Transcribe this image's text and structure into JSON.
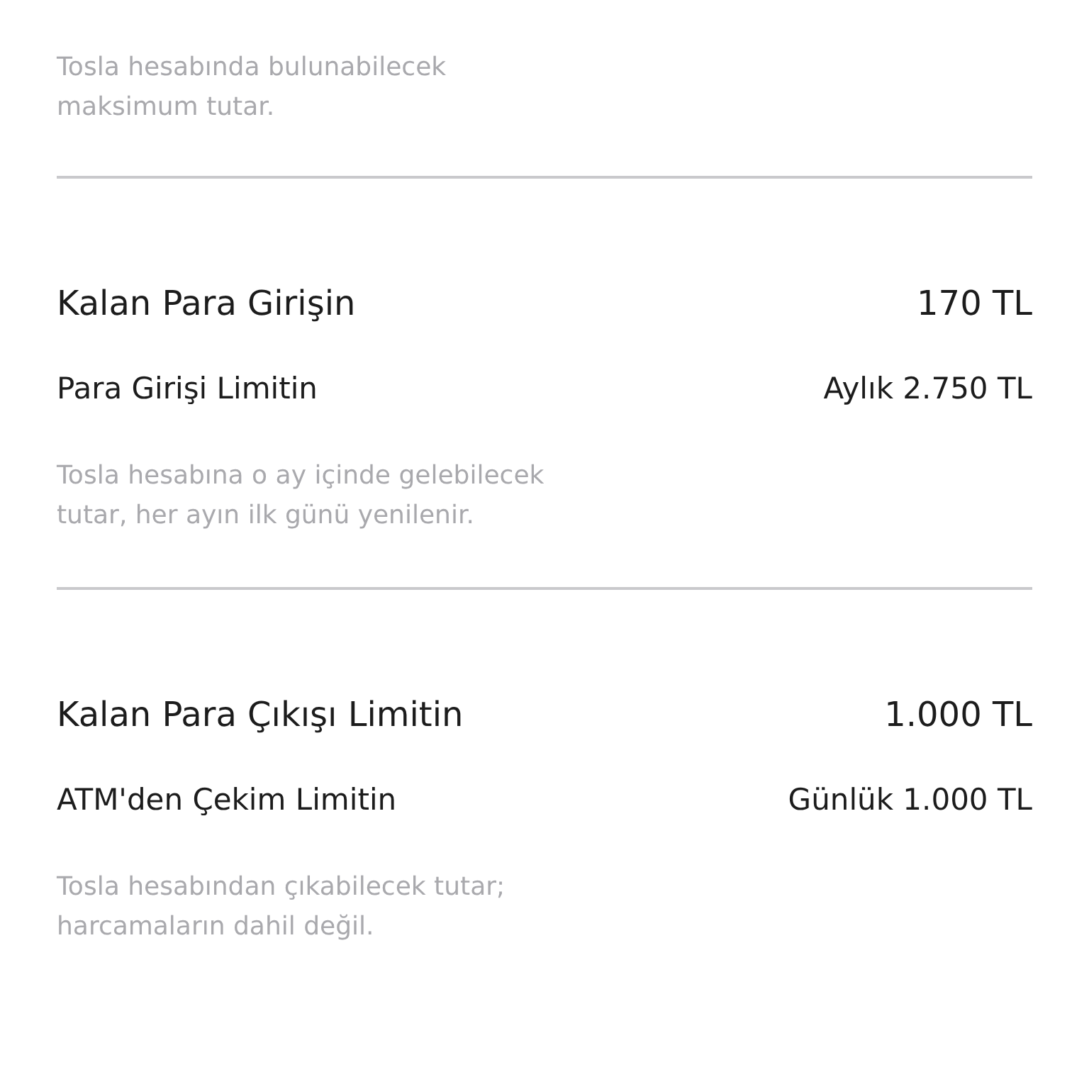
{
  "sections": [
    {
      "description": "Tosla hesabında bulunabilecek maksimum tutar."
    },
    {
      "title": "Kalan Para Girişin",
      "amount": "170 TL",
      "limit_label": "Para Girişi Limitin",
      "limit_value": "Aylık 2.750 TL",
      "description": "Tosla hesabına o ay içinde gelebilecek tutar, her ayın ilk günü yenilenir."
    },
    {
      "title": "Kalan Para Çıkışı Limitin",
      "amount": "1.000 TL",
      "limit_label": "ATM'den Çekim Limitin",
      "limit_value": "Günlük 1.000 TL",
      "description": "Tosla hesabından çıkabilecek tutar; harcamaların dahil değil."
    }
  ]
}
